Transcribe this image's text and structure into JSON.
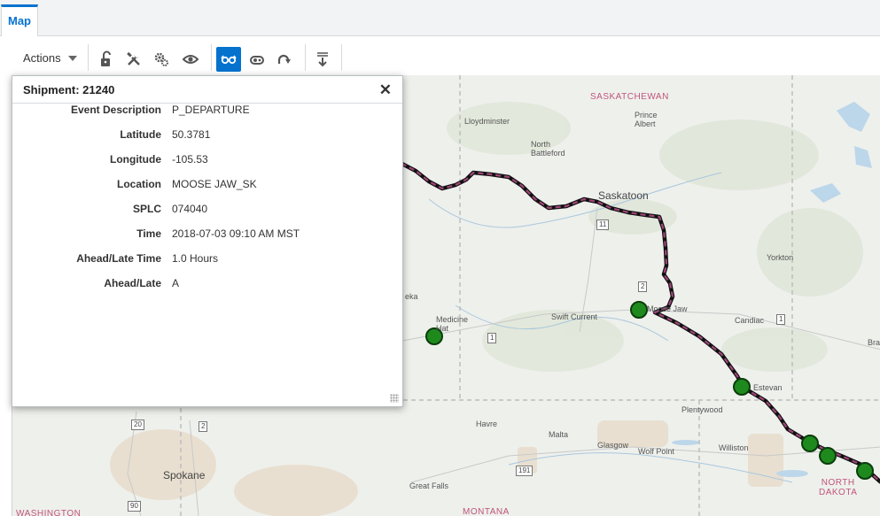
{
  "tabs": [
    {
      "label": "Map"
    }
  ],
  "toolbar": {
    "actions_label": "Actions",
    "buttons": [
      {
        "icon": "unlock-icon"
      },
      {
        "icon": "tools-icon"
      },
      {
        "icon": "settings-gears-icon"
      },
      {
        "icon": "eye-icon"
      },
      {
        "icon": "glasses-icon",
        "active": true
      },
      {
        "icon": "route-icon"
      },
      {
        "icon": "redo-icon"
      },
      {
        "icon": "filter-down-icon"
      }
    ]
  },
  "popup": {
    "title": "Shipment: 21240",
    "fields": [
      {
        "label": "Event Description",
        "value": "P_DEPARTURE"
      },
      {
        "label": "Latitude",
        "value": "50.3781"
      },
      {
        "label": "Longitude",
        "value": "-105.53"
      },
      {
        "label": "Location",
        "value": "MOOSE JAW_SK"
      },
      {
        "label": "SPLC",
        "value": "074040"
      },
      {
        "label": "Time",
        "value": "2018-07-03 09:10 AM MST"
      },
      {
        "label": "Ahead/Late Time",
        "value": "1.0 Hours"
      },
      {
        "label": "Ahead/Late",
        "value": "A"
      }
    ]
  },
  "map": {
    "labels": {
      "saskatchewan": "SASKATCHEWAN",
      "lloydminster": "Lloydminster",
      "prince_albert": "Prince\nAlbert",
      "north_battleford": "North\nBattleford",
      "saskatoon": "Saskatoon",
      "yorkton": "Yorkton",
      "medicine_hat": "Medicine\nHat",
      "swift_current": "Swift Current",
      "moose_jaw": "Moose Jaw",
      "candiac": "Candiac",
      "estevan": "Estevan",
      "plentywood": "Plentywood",
      "havre": "Havre",
      "malta": "Malta",
      "glasgow": "Glasgow",
      "wolf_point": "Wolf Point",
      "williston": "Williston",
      "spokane": "Spokane",
      "great_falls": "Great Falls",
      "montana": "MONTANA",
      "north_dakota": "NORTH\nDAKOTA",
      "washington": "WASHINGTON",
      "brandon": "Bra",
      "etka": "eka"
    },
    "shields": [
      "11",
      "2",
      "1",
      "1",
      "20",
      "2",
      "191",
      "90"
    ],
    "route_color": "#a0477a",
    "marker_color": "#1e8a1e"
  }
}
